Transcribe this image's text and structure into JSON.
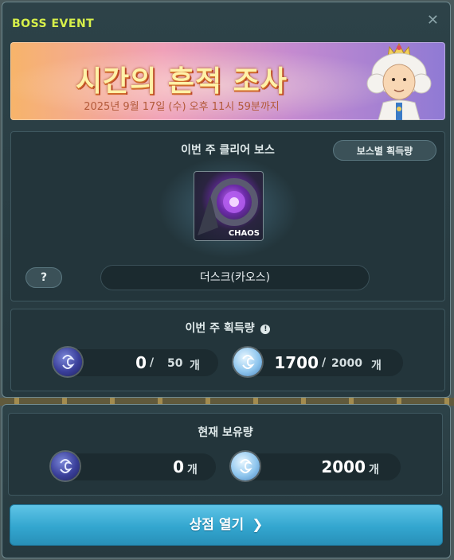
{
  "window": {
    "title": "BOSS EVENT",
    "close_icon": "close-icon"
  },
  "banner": {
    "title": "시간의 흔적 조사",
    "subtitle": "2025년 9월 17일 (수) 오후 11시 59분까지"
  },
  "clear_boss": {
    "header": "이번 주 클리어 보스",
    "per_boss_button": "보스별 획득량",
    "boss_badge": "CHAOS",
    "help_label": "?",
    "boss_name": "더스크(카오스)"
  },
  "weekly": {
    "header": "이번 주 획득량",
    "coin1": {
      "value": "0",
      "sep": "/",
      "max": "50",
      "unit": "개"
    },
    "coin2": {
      "value": "1700",
      "sep": "/",
      "max": "2000",
      "unit": "개"
    }
  },
  "owned": {
    "header": "현재 보유량",
    "coin1": {
      "value": "0",
      "unit": "개"
    },
    "coin2": {
      "value": "2000",
      "unit": "개"
    }
  },
  "shop_button": {
    "label": "상점 열기",
    "arrow": "❯"
  },
  "colors": {
    "title": "#d7f04a",
    "button": "#33a6cf"
  }
}
